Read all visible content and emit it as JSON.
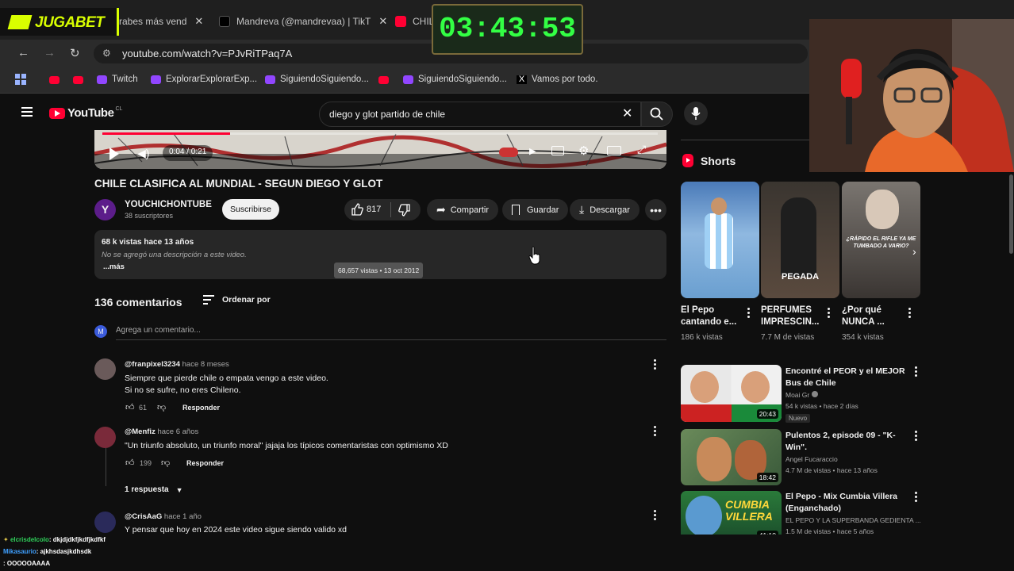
{
  "browser": {
    "tabs": [
      {
        "label": "rabes más vend"
      },
      {
        "label": "Mandreva (@mandrevaa) | TikT"
      },
      {
        "label": "CHIL"
      }
    ],
    "url": "youtube.com/watch?v=PJvRiTPaq7A",
    "bookmarks": [
      {
        "label": "Twitch"
      },
      {
        "label": "ExplorarExplorarExp..."
      },
      {
        "label": "SiguiendoSiguiendo..."
      },
      {
        "label": "SiguiendoSiguiendo..."
      },
      {
        "label": "Vamos por todo."
      }
    ]
  },
  "overlay": {
    "brand": "JUGABET",
    "timer": "03:43:53"
  },
  "youtube": {
    "logo": "YouTube",
    "country": "CL",
    "search_value": "diego y glot partido de chile"
  },
  "player": {
    "time": "0:04 / 0:21",
    "progress": 0.23
  },
  "video": {
    "title": "CHILE CLASIFICA AL MUNDIAL - SEGUN DIEGO Y GLOT",
    "channel": "YOUCHICHONTUBE",
    "channel_initial": "Y",
    "subscribers": "38 suscriptores",
    "subscribe_label": "Suscribirse",
    "likes": "817",
    "share_label": "Compartir",
    "save_label": "Guardar",
    "download_label": "Descargar",
    "description": {
      "stats": "68 k vistas  hace 13 años",
      "text": "No se agregó una descripción a este video.",
      "more": "...más",
      "tooltip": "68,657 vistas • 13 oct 2012"
    }
  },
  "comments": {
    "count_label": "136 comentarios",
    "sort_label": "Ordenar por",
    "user_initial": "M",
    "add_placeholder": "Agrega un comentario...",
    "reply_label": "Responder",
    "items": [
      {
        "handle": "@franpixel3234",
        "when": "hace 8 meses",
        "lines": [
          "Siempre que pierde chile o empata vengo a este video.",
          "Si no se sufre, no eres Chileno."
        ],
        "likes": "61"
      },
      {
        "handle": "@Menfiz",
        "when": "hace 6 años",
        "lines": [
          "\"Un triunfo absoluto, un triunfo moral\" jajaja los típicos comentaristas con optimismo XD"
        ],
        "likes": "199",
        "replies": "1 respuesta"
      },
      {
        "handle": "@CrisAaG",
        "when": "hace 1 año",
        "lines": [
          "Y pensar que hoy en 2024 este video sigue siendo valido xd"
        ]
      }
    ]
  },
  "shorts": {
    "heading": "Shorts",
    "items": [
      {
        "title": "El Pepo cantando e...",
        "views": "186 k vistas"
      },
      {
        "title": "PERFUMES IMPRESCIN...",
        "views": "7.7 M de vistas",
        "overlay": "PEGADA"
      },
      {
        "title": "¿Por qué NUNCA ...",
        "views": "354 k vistas",
        "overlay": "¿RÁPIDO EL RIFLE YA ME TUMBADO A VARIO?"
      }
    ]
  },
  "recommended": [
    {
      "title": [
        "Encontré el PEOR y el MEJOR",
        "Bus de Chile"
      ],
      "channel": "Moai Gr",
      "meta": "54 k vistas • hace 2 días",
      "badge": "Nuevo",
      "duration": "20:43"
    },
    {
      "title": [
        "Pulentos 2, episode 09 - \"K-",
        "Win\"."
      ],
      "channel": "Angel Fucaraccio",
      "meta": "4.7 M de vistas • hace 13 años",
      "duration": "18:42"
    },
    {
      "title": [
        "El Pepo - Mix Cumbia Villera",
        "(Enganchado)"
      ],
      "channel": "EL PEPO Y LA SUPERBANDA GEDIENTA ...",
      "meta": "1.5 M de vistas • hace 5 años",
      "duration": "41:10",
      "thumb_text": "CUMBIA VILLERA"
    }
  ],
  "chat": [
    {
      "user": "elcrisdelcolo",
      "text": ": dkjdjdkfjkdfjkdfkf"
    },
    {
      "user": "Mikasaurio",
      "text": ": ajkhsdasjkdhsdk"
    },
    {
      "user": "",
      "text": ": OOOOOAAAA"
    }
  ],
  "colors": {
    "youtube_red": "#ff0033",
    "background": "#0f0f0f",
    "timer_green": "#33ff44",
    "twitch_purple": "#9146ff"
  }
}
